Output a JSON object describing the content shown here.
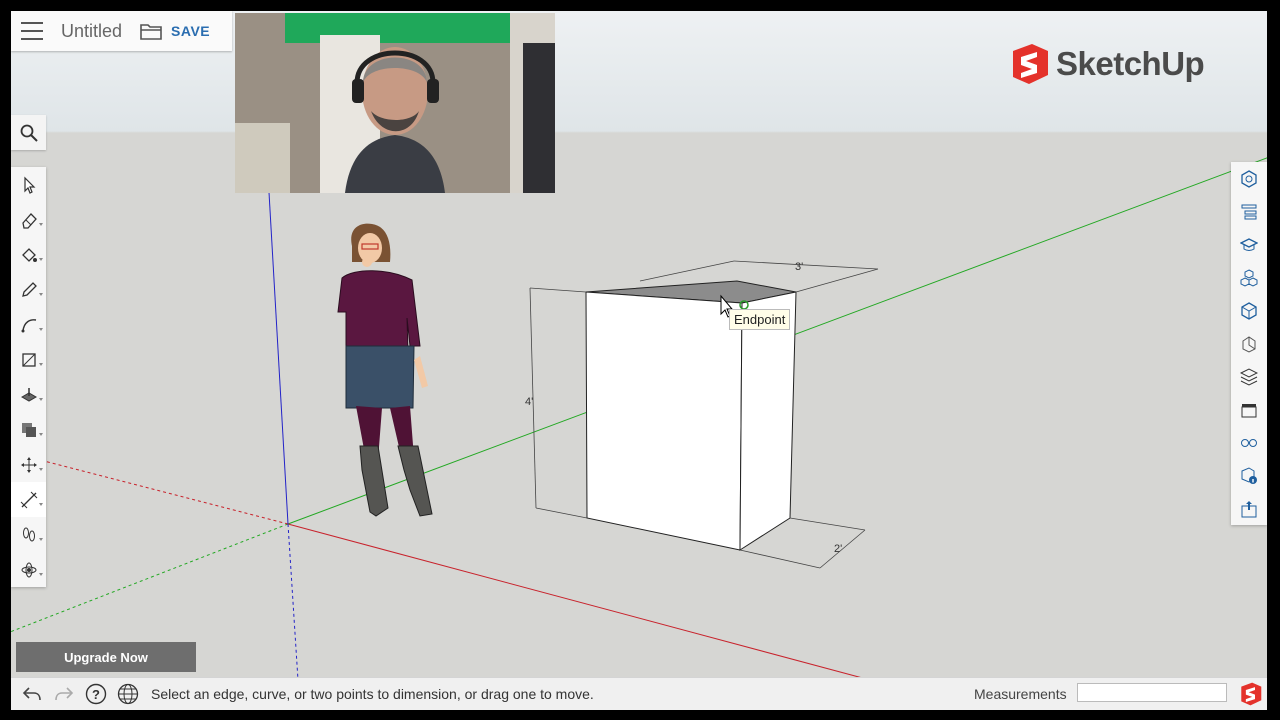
{
  "app": {
    "name": "SketchUp",
    "file_title": "Untitled",
    "save_label": "SAVE"
  },
  "left_toolbar": {
    "tools": [
      {
        "name": "select-tool",
        "icon": "arrow-cursor-icon"
      },
      {
        "name": "eraser-tool",
        "icon": "eraser-icon"
      },
      {
        "name": "paint-bucket-tool",
        "icon": "paint-icon"
      },
      {
        "name": "line-tool",
        "icon": "pencil-icon"
      },
      {
        "name": "arc-tool",
        "icon": "arc-icon"
      },
      {
        "name": "rectangle-tool",
        "icon": "rectangle-icon"
      },
      {
        "name": "push-pull-tool",
        "icon": "push-pull-icon"
      },
      {
        "name": "offset-tool",
        "icon": "offset-icon"
      },
      {
        "name": "move-tool",
        "icon": "move-icon"
      },
      {
        "name": "dimension-tool",
        "icon": "dimension-icon",
        "active": true
      },
      {
        "name": "walk-tool",
        "icon": "footprints-icon"
      },
      {
        "name": "orbit-tool",
        "icon": "orbit-icon"
      }
    ]
  },
  "right_toolbar": {
    "panels": [
      "entity-info-icon",
      "outliner-icon",
      "instructor-icon",
      "components-icon",
      "materials-icon",
      "styles-icon",
      "layers-icon",
      "scenes-icon",
      "display-icon",
      "model-info-icon",
      "export-icon"
    ]
  },
  "viewport": {
    "tooltip": "Endpoint",
    "dimensions": {
      "width": "3'",
      "height": "4'",
      "depth": "2'"
    }
  },
  "upgrade_label": "Upgrade Now",
  "statusbar": {
    "hint": "Select an edge, curve, or two points to dimension, or drag one to move.",
    "measurements_label": "Measurements",
    "measurements_value": ""
  },
  "colors": {
    "accent": "#2a6db0",
    "brand_red": "#e4322b",
    "axis_red": "#c8232c",
    "axis_green": "#23a823",
    "axis_blue": "#2323c8"
  }
}
